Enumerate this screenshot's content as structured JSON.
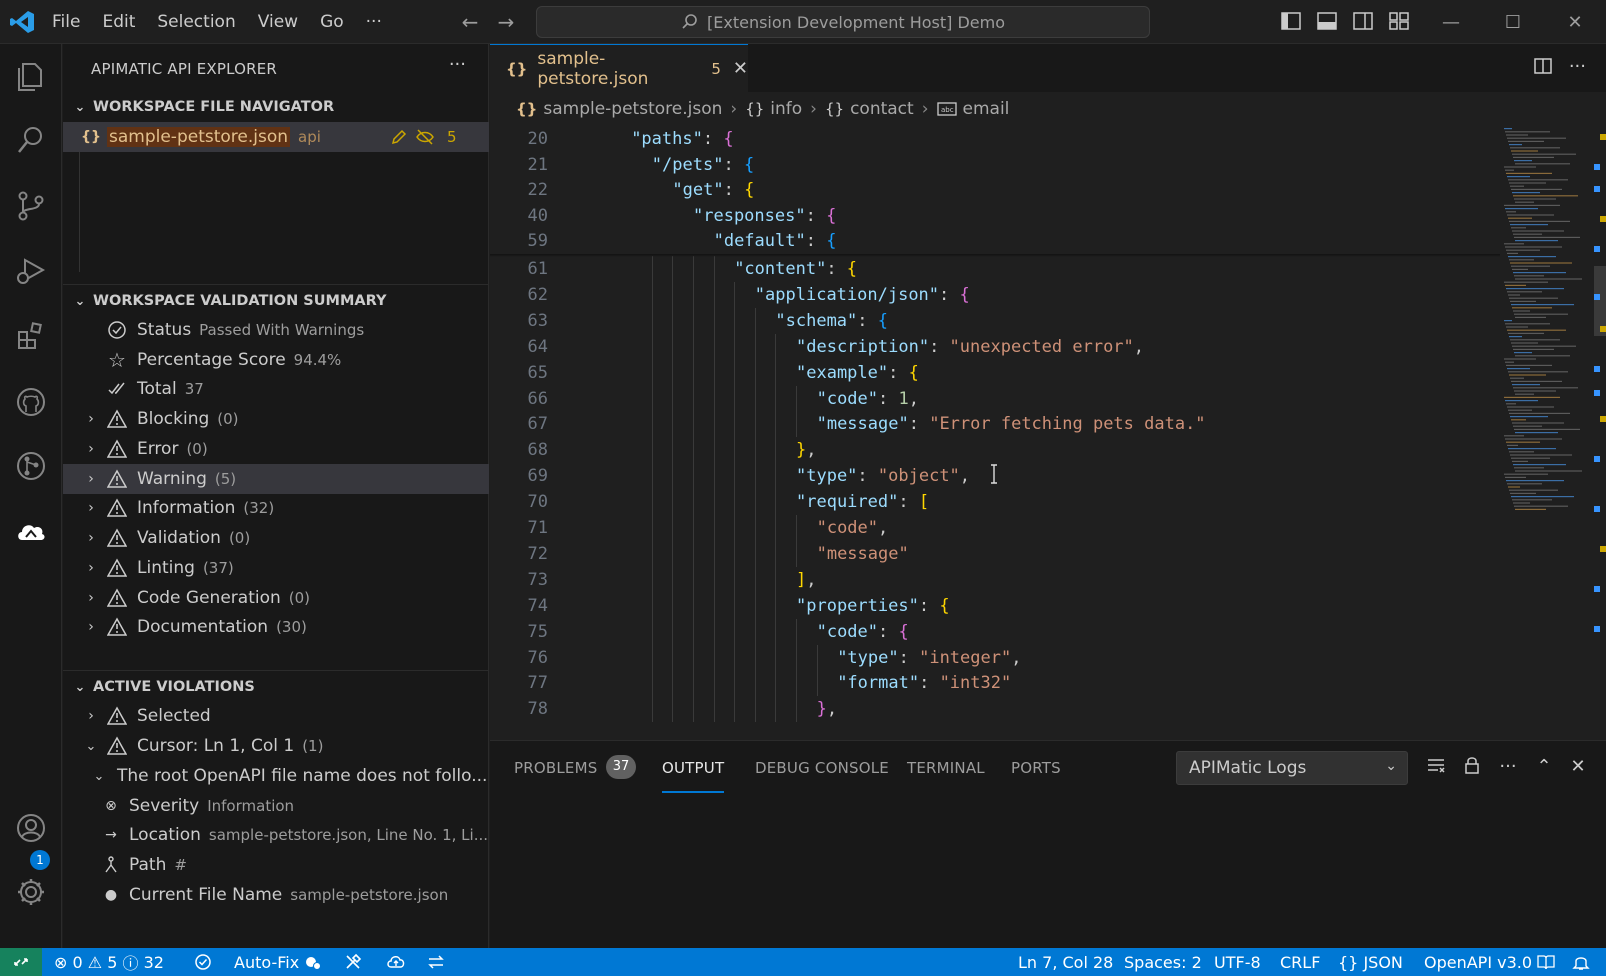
{
  "menu": [
    "File",
    "Edit",
    "Selection",
    "View",
    "Go",
    "···"
  ],
  "command_center": "[Extension Development Host] Demo",
  "sidebar": {
    "title": "APIMATIC API EXPLORER",
    "navigator": {
      "heading": "WORKSPACE FILE NAVIGATOR",
      "file": {
        "name": "sample-petstore.json",
        "tag": "api",
        "count": "5"
      }
    },
    "summary": {
      "heading": "WORKSPACE VALIDATION SUMMARY",
      "status": {
        "label": "Status",
        "value": "Passed With Warnings"
      },
      "score": {
        "label": "Percentage Score",
        "value": "94.4%"
      },
      "total": {
        "label": "Total",
        "value": "37"
      },
      "categories": [
        {
          "label": "Blocking",
          "count": "(0)"
        },
        {
          "label": "Error",
          "count": "(0)"
        },
        {
          "label": "Warning",
          "count": "(5)"
        },
        {
          "label": "Information",
          "count": "(32)"
        },
        {
          "label": "Validation",
          "count": "(0)"
        },
        {
          "label": "Linting",
          "count": "(37)"
        },
        {
          "label": "Code Generation",
          "count": "(0)"
        },
        {
          "label": "Documentation",
          "count": "(30)"
        }
      ]
    },
    "violations": {
      "heading": "ACTIVE VIOLATIONS",
      "selected": "Selected",
      "cursor": {
        "label": "Cursor: Ln 1, Col 1",
        "count": "(1)"
      },
      "rule": "The root OpenAPI file name does not follo...",
      "severity": {
        "label": "Severity",
        "value": "Information"
      },
      "location": {
        "label": "Location",
        "value": "sample-petstore.json, Line No. 1, Li..."
      },
      "path": {
        "label": "Path",
        "value": "#"
      },
      "current_file": {
        "label": "Current File Name",
        "value": "sample-petstore.json"
      }
    }
  },
  "tab": {
    "name": "sample-petstore.json",
    "count": "5"
  },
  "breadcrumb": [
    "sample-petstore.json",
    "info",
    "contact",
    "email"
  ],
  "sticky_lines": [
    {
      "n": "20",
      "indent": 2,
      "key": "\"paths\"",
      "open": "{",
      "bc": "b2"
    },
    {
      "n": "21",
      "indent": 3,
      "key": "\"/pets\"",
      "open": "{",
      "bc": "b3"
    },
    {
      "n": "22",
      "indent": 4,
      "key": "\"get\"",
      "open": "{",
      "bc": "b1"
    },
    {
      "n": "40",
      "indent": 5,
      "key": "\"responses\"",
      "open": "{",
      "bc": "b2"
    },
    {
      "n": "59",
      "indent": 6,
      "key": "\"default\"",
      "open": "{",
      "bc": "b3"
    }
  ],
  "code_lines": [
    {
      "n": "61",
      "indent": 7,
      "key": "\"content\"",
      "open": "{",
      "bc": "b1"
    },
    {
      "n": "62",
      "indent": 8,
      "key": "\"application/json\"",
      "open": "{",
      "bc": "b2"
    },
    {
      "n": "63",
      "indent": 9,
      "key": "\"schema\"",
      "open": "{",
      "bc": "b3"
    },
    {
      "n": "64",
      "indent": 10,
      "key": "\"description\"",
      "str": "\"unexpected error\"",
      "comma": ","
    },
    {
      "n": "65",
      "indent": 10,
      "key": "\"example\"",
      "open": "{",
      "bc": "b1"
    },
    {
      "n": "66",
      "indent": 11,
      "key": "\"code\"",
      "num": "1",
      "comma": ","
    },
    {
      "n": "67",
      "indent": 11,
      "key": "\"message\"",
      "str": "\"Error fetching pets data.\""
    },
    {
      "n": "68",
      "indent": 10,
      "close": "}",
      "bc": "b1",
      "comma": ","
    },
    {
      "n": "69",
      "indent": 10,
      "key": "\"type\"",
      "str": "\"object\"",
      "comma": ","
    },
    {
      "n": "70",
      "indent": 10,
      "key": "\"required\"",
      "open": "[",
      "bc": "b1"
    },
    {
      "n": "71",
      "indent": 11,
      "str": "\"code\"",
      "comma": ","
    },
    {
      "n": "72",
      "indent": 11,
      "str": "\"message\""
    },
    {
      "n": "73",
      "indent": 10,
      "close": "]",
      "bc": "b1",
      "comma": ","
    },
    {
      "n": "74",
      "indent": 10,
      "key": "\"properties\"",
      "open": "{",
      "bc": "b1"
    },
    {
      "n": "75",
      "indent": 11,
      "key": "\"code\"",
      "open": "{",
      "bc": "b2"
    },
    {
      "n": "76",
      "indent": 12,
      "key": "\"type\"",
      "str": "\"integer\"",
      "comma": ","
    },
    {
      "n": "77",
      "indent": 12,
      "key": "\"format\"",
      "str": "\"int32\""
    },
    {
      "n": "78",
      "indent": 11,
      "close": "}",
      "bc": "b2",
      "comma": ","
    }
  ],
  "panel": {
    "tabs": [
      "PROBLEMS",
      "OUTPUT",
      "DEBUG CONSOLE",
      "TERMINAL",
      "PORTS"
    ],
    "problems_count": "37",
    "active_tab": "OUTPUT",
    "log_channel": "APIMatic Logs"
  },
  "status": {
    "errors": "0",
    "warnings": "5",
    "infos": "32",
    "autofix": "Auto-Fix",
    "position": "Ln 7, Col 28",
    "spaces": "Spaces: 2",
    "encoding": "UTF-8",
    "eol": "CRLF",
    "language": "JSON",
    "openapi": "OpenAPI v3.0"
  },
  "accounts_badge": "1",
  "colors": {
    "accent": "#0078d4",
    "status_bar": "#0078d4",
    "warning": "#cca700",
    "modified": "#e2c08d"
  }
}
